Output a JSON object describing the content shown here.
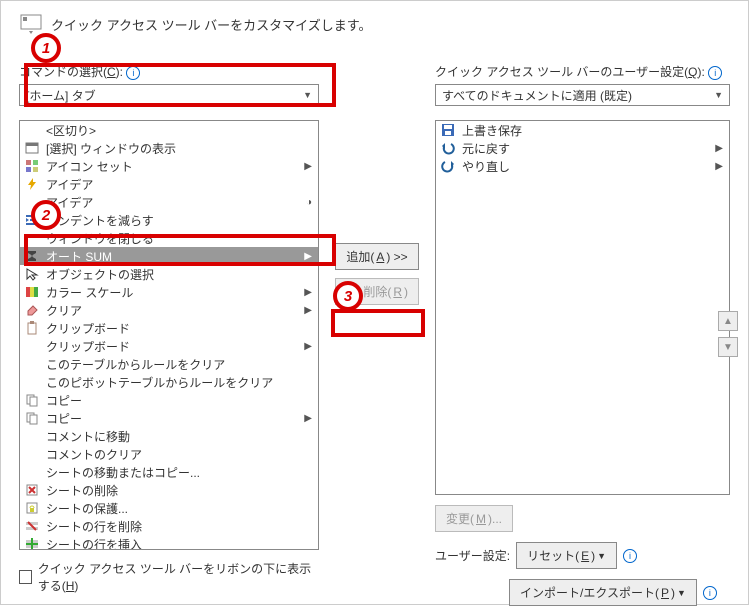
{
  "header": {
    "title": "クイック アクセス ツール バーをカスタマイズします。"
  },
  "left": {
    "choose_label_prefix": "コマンドの選択(",
    "choose_label_key": "C",
    "choose_label_suffix": "):",
    "select_value": "[ホーム] タブ",
    "items": [
      {
        "label": "<区切り>",
        "icon": "",
        "sub": false
      },
      {
        "label": "[選択] ウィンドウの表示",
        "icon": "window",
        "sub": false
      },
      {
        "label": "アイコン セット",
        "icon": "grid",
        "sub": true
      },
      {
        "label": "アイデア",
        "icon": "lightning",
        "sub": false
      },
      {
        "label": "アイデア",
        "icon": "blank",
        "sub": true,
        "subIcon": "circle"
      },
      {
        "label": "インデントを減らす",
        "icon": "indent",
        "sub": false
      },
      {
        "label": "ウィンドウを閉じる",
        "icon": "blank",
        "sub": false
      },
      {
        "label": "オート SUM",
        "icon": "sigma",
        "sub": true,
        "selected": true
      },
      {
        "label": "オブジェクトの選択",
        "icon": "arrow",
        "sub": false
      },
      {
        "label": "カラー スケール",
        "icon": "palette",
        "sub": true
      },
      {
        "label": "クリア",
        "icon": "eraser",
        "sub": true
      },
      {
        "label": "クリップボード",
        "icon": "clipboard",
        "sub": false
      },
      {
        "label": "クリップボード",
        "icon": "blank",
        "sub": true
      },
      {
        "label": "このテーブルからルールをクリア",
        "icon": "blank",
        "sub": false
      },
      {
        "label": "このピボットテーブルからルールをクリア",
        "icon": "blank",
        "sub": false
      },
      {
        "label": "コピー",
        "icon": "copy",
        "sub": false
      },
      {
        "label": "コピー",
        "icon": "copy",
        "sub": true
      },
      {
        "label": "コメントに移動",
        "icon": "blank",
        "sub": false
      },
      {
        "label": "コメントのクリア",
        "icon": "blank",
        "sub": false
      },
      {
        "label": "シートの移動またはコピー...",
        "icon": "blank",
        "sub": false
      },
      {
        "label": "シートの削除",
        "icon": "sheet-del",
        "sub": false
      },
      {
        "label": "シートの保護...",
        "icon": "sheet-lock",
        "sub": false
      },
      {
        "label": "シートの行を削除",
        "icon": "row-del",
        "sub": false
      },
      {
        "label": "シートの行を挿入",
        "icon": "row-ins",
        "sub": false
      }
    ],
    "checkbox_prefix": "クイック アクセス ツール バーをリボンの下に表示する(",
    "checkbox_key": "H",
    "checkbox_suffix": ")"
  },
  "middle": {
    "add_prefix": "追加(",
    "add_key": "A",
    "add_suffix": ") >>",
    "remove_prefix": "<< 削除(",
    "remove_key": "R",
    "remove_suffix": ")"
  },
  "right": {
    "label_prefix": "クイック アクセス ツール バーのユーザー設定(",
    "label_key": "Q",
    "label_suffix": "):",
    "select_value": "すべてのドキュメントに適用 (既定)",
    "items": [
      {
        "label": "上書き保存",
        "icon": "floppy",
        "sub": false
      },
      {
        "label": "元に戻す",
        "icon": "undo",
        "sub": true
      },
      {
        "label": "やり直し",
        "icon": "redo",
        "sub": true
      }
    ],
    "modify_prefix": "変更(",
    "modify_key": "M",
    "modify_suffix": ")...",
    "user_label": "ユーザー設定:",
    "reset_prefix": "リセット(",
    "reset_key": "E",
    "reset_suffix": ")",
    "impexp_prefix": "インポート/エクスポート(",
    "impexp_key": "P",
    "impexp_suffix": ")"
  },
  "annotations": {
    "n1": "1",
    "n2": "2",
    "n3": "3"
  }
}
